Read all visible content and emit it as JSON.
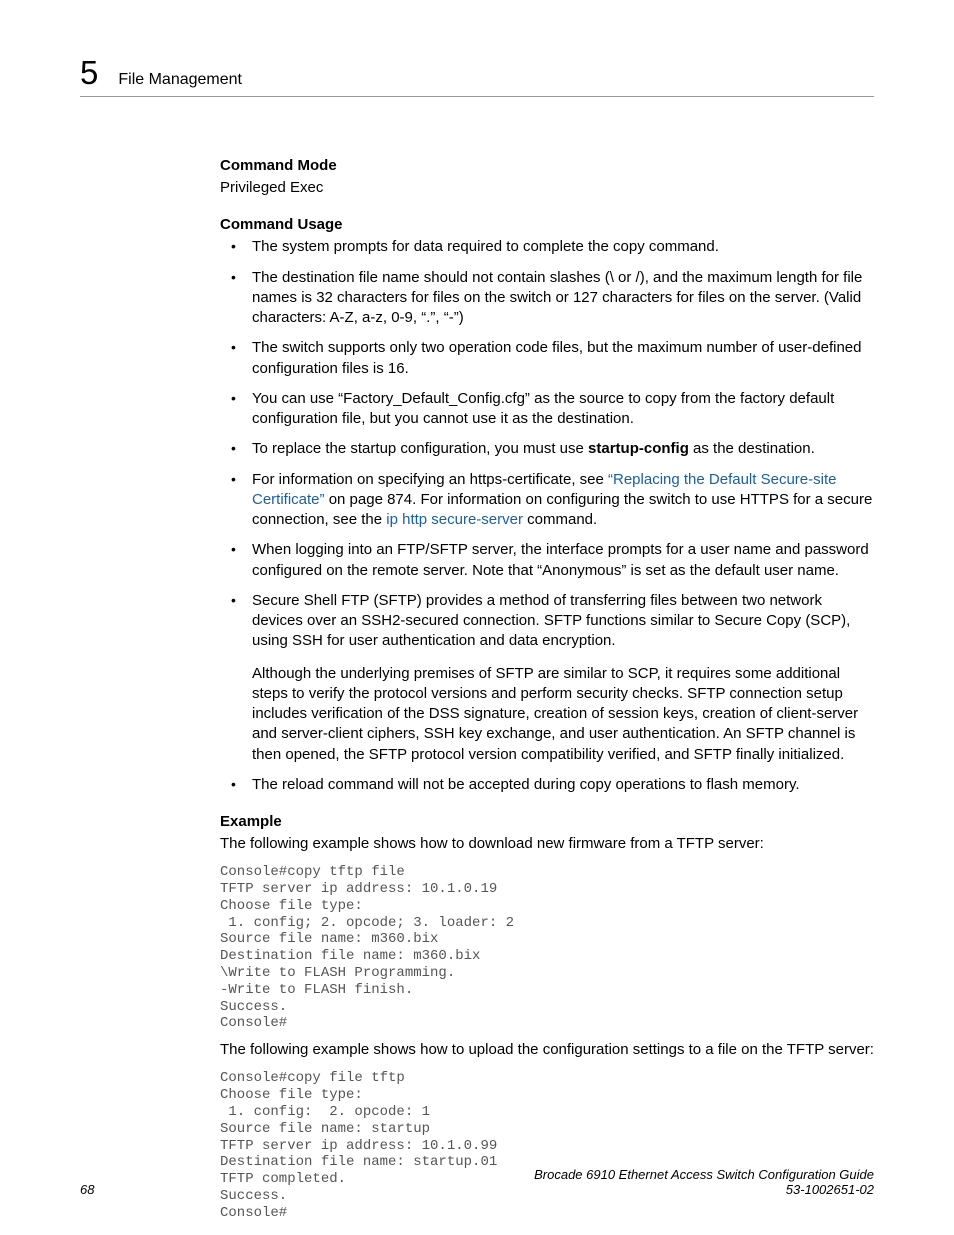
{
  "header": {
    "chapter_num": "5",
    "chapter_title": "File Management"
  },
  "section_command_mode": {
    "heading": "Command Mode",
    "text": "Privileged Exec"
  },
  "section_command_usage": {
    "heading": "Command Usage",
    "bullet1": "The system prompts for data required to complete the copy command.",
    "bullet2": "The destination file name should not contain slashes (\\ or /), and the maximum length for file names is 32 characters for files on the switch or 127 characters for files on the server. (Valid characters: A-Z, a-z, 0-9, “.”, “-”)",
    "bullet3": "The switch supports only two operation code files, but the maximum number of user-defined configuration files is 16.",
    "bullet4": "You can use “Factory_Default_Config.cfg” as the source to copy from the factory default configuration file, but you cannot use it as the destination.",
    "bullet5_a": "To replace the startup configuration, you must use ",
    "bullet5_bold": "startup-config",
    "bullet5_b": " as the destination.",
    "bullet6_a": "For information on specifying an https-certificate, see ",
    "bullet6_link1": "“Replacing the Default Secure-site Certificate”",
    "bullet6_b": " on page 874. For information on configuring the switch to use HTTPS for a secure connection, see the ",
    "bullet6_link2": "ip http secure-server",
    "bullet6_c": " command.",
    "bullet7": "When logging into an FTP/SFTP server, the interface prompts for a user name and password configured on the remote server. Note that “Anonymous” is set as the default user name.",
    "bullet8": "Secure Shell FTP (SFTP) provides a method of transferring files between two network devices over an SSH2-secured connection. SFTP functions similar to Secure Copy (SCP), using SSH for user authentication and data encryption.",
    "bullet8_sub": "Although the underlying premises of SFTP are similar to SCP, it requires some additional steps to verify the protocol versions and perform security checks. SFTP connection setup includes verification of the DSS signature, creation of session keys, creation of client-server and server-client ciphers, SSH key exchange, and user authentication. An SFTP channel is then opened, the SFTP protocol version compatibility verified, and SFTP finally initialized.",
    "bullet9": "The reload command will not be accepted during copy operations to flash memory."
  },
  "section_example": {
    "heading": "Example",
    "intro1": "The following example shows how to download new firmware from a TFTP server:",
    "code1": "Console#copy tftp file\nTFTP server ip address: 10.1.0.19\nChoose file type:\n 1. config; 2. opcode; 3. loader: 2\nSource file name: m360.bix\nDestination file name: m360.bix\n\\Write to FLASH Programming.\n-Write to FLASH finish.\nSuccess.\nConsole#",
    "intro2": "The following example shows how to upload the configuration settings to a file on the TFTP server:",
    "code2": "Console#copy file tftp\nChoose file type:\n 1. config:  2. opcode: 1\nSource file name: startup\nTFTP server ip address: 10.1.0.99\nDestination file name: startup.01\nTFTP completed.\nSuccess.\nConsole#"
  },
  "footer": {
    "page_num": "68",
    "doc_title": "Brocade 6910 Ethernet Access Switch Configuration Guide",
    "doc_id": "53-1002651-02"
  }
}
